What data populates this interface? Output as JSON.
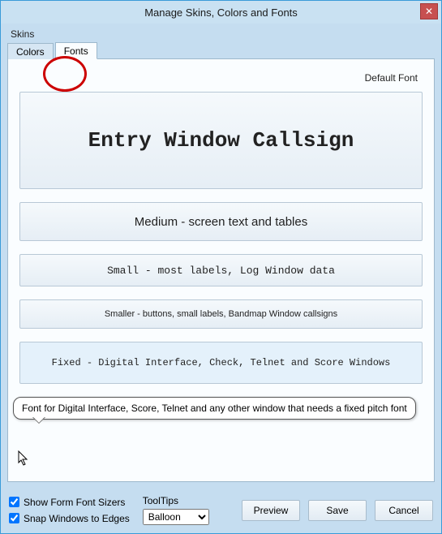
{
  "window": {
    "title": "Manage Skins, Colors and Fonts",
    "close": "✕"
  },
  "skins_label": "Skins",
  "tabs": {
    "colors": "Colors",
    "fonts": "Fonts"
  },
  "panel": {
    "default_font_label": "Default Font",
    "callsign": "Entry Window Callsign",
    "medium": "Medium - screen text and tables",
    "small": "Small - most labels, Log Window data",
    "smaller": "Smaller - buttons, small labels, Bandmap Window callsigns",
    "fixed": "Fixed - Digital Interface, Check, Telnet and Score Windows",
    "tooltip_text": "Font for Digital Interface, Score, Telnet and any other window that needs a fixed pitch font"
  },
  "bottom": {
    "show_sizers": "Show Form Font Sizers",
    "snap_edges": "Snap Windows to Edges",
    "tooltips_label": "ToolTips",
    "tooltips_value": "Balloon",
    "preview": "Preview",
    "save": "Save",
    "cancel": "Cancel"
  }
}
